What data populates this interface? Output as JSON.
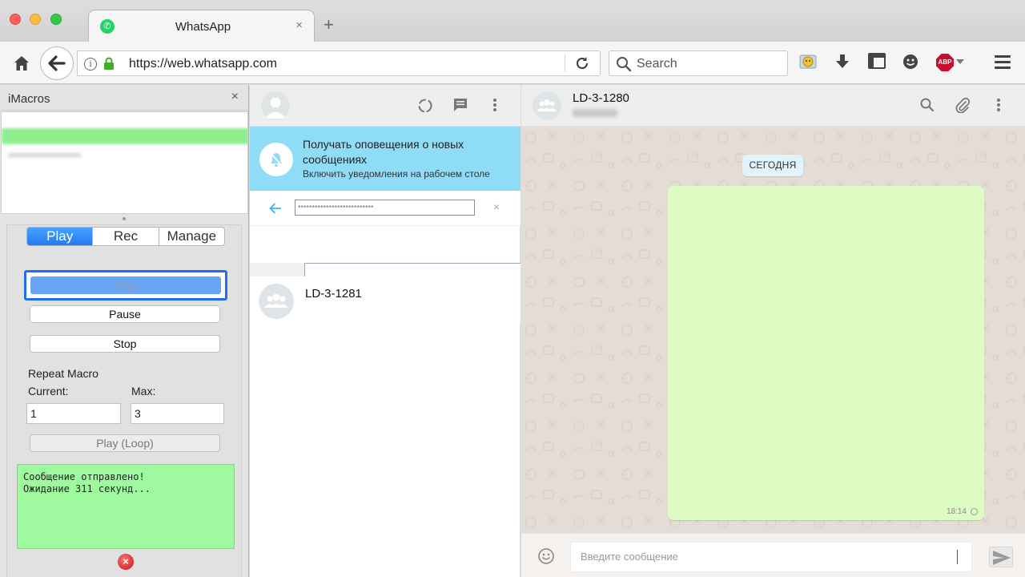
{
  "browser": {
    "tab_title": "WhatsApp",
    "tab_close": "×",
    "new_tab": "+",
    "url": "https://web.whatsapp.com",
    "search_placeholder": "Search"
  },
  "imacros": {
    "title": "iMacros",
    "close": "×",
    "tabs": [
      {
        "label": "Play",
        "active": true
      },
      {
        "label": "Rec",
        "active": false
      },
      {
        "label": "Manage",
        "active": false
      }
    ],
    "buttons": {
      "play": "Play",
      "pause": "Pause",
      "stop": "Stop",
      "play_loop": "Play (Loop)"
    },
    "repeat_label": "Repeat Macro",
    "current_label": "Current:",
    "max_label": "Max:",
    "current_value": "1",
    "max_value": "3",
    "status_line1": "Сообщение отправлено!",
    "status_line2": "Ожидание 311 секунд..."
  },
  "chatlist": {
    "notify_title": "Получать оповещения о новых сообщениях",
    "notify_sub": "Включить уведомления на рабочем столе",
    "search_clear": "×",
    "chats": [
      {
        "name": "LD-3-1281"
      }
    ]
  },
  "conversation": {
    "name": "LD-3-1280",
    "date_chip": "СЕГОДНЯ",
    "message_time": "18:14",
    "input_placeholder": "Введите сообщение"
  },
  "colors": {
    "notify_bg": "#8fdcf7",
    "bubble_bg": "#dcfcc4",
    "status_bg": "#9ff99f",
    "accent_blue": "#1f7cf2"
  }
}
